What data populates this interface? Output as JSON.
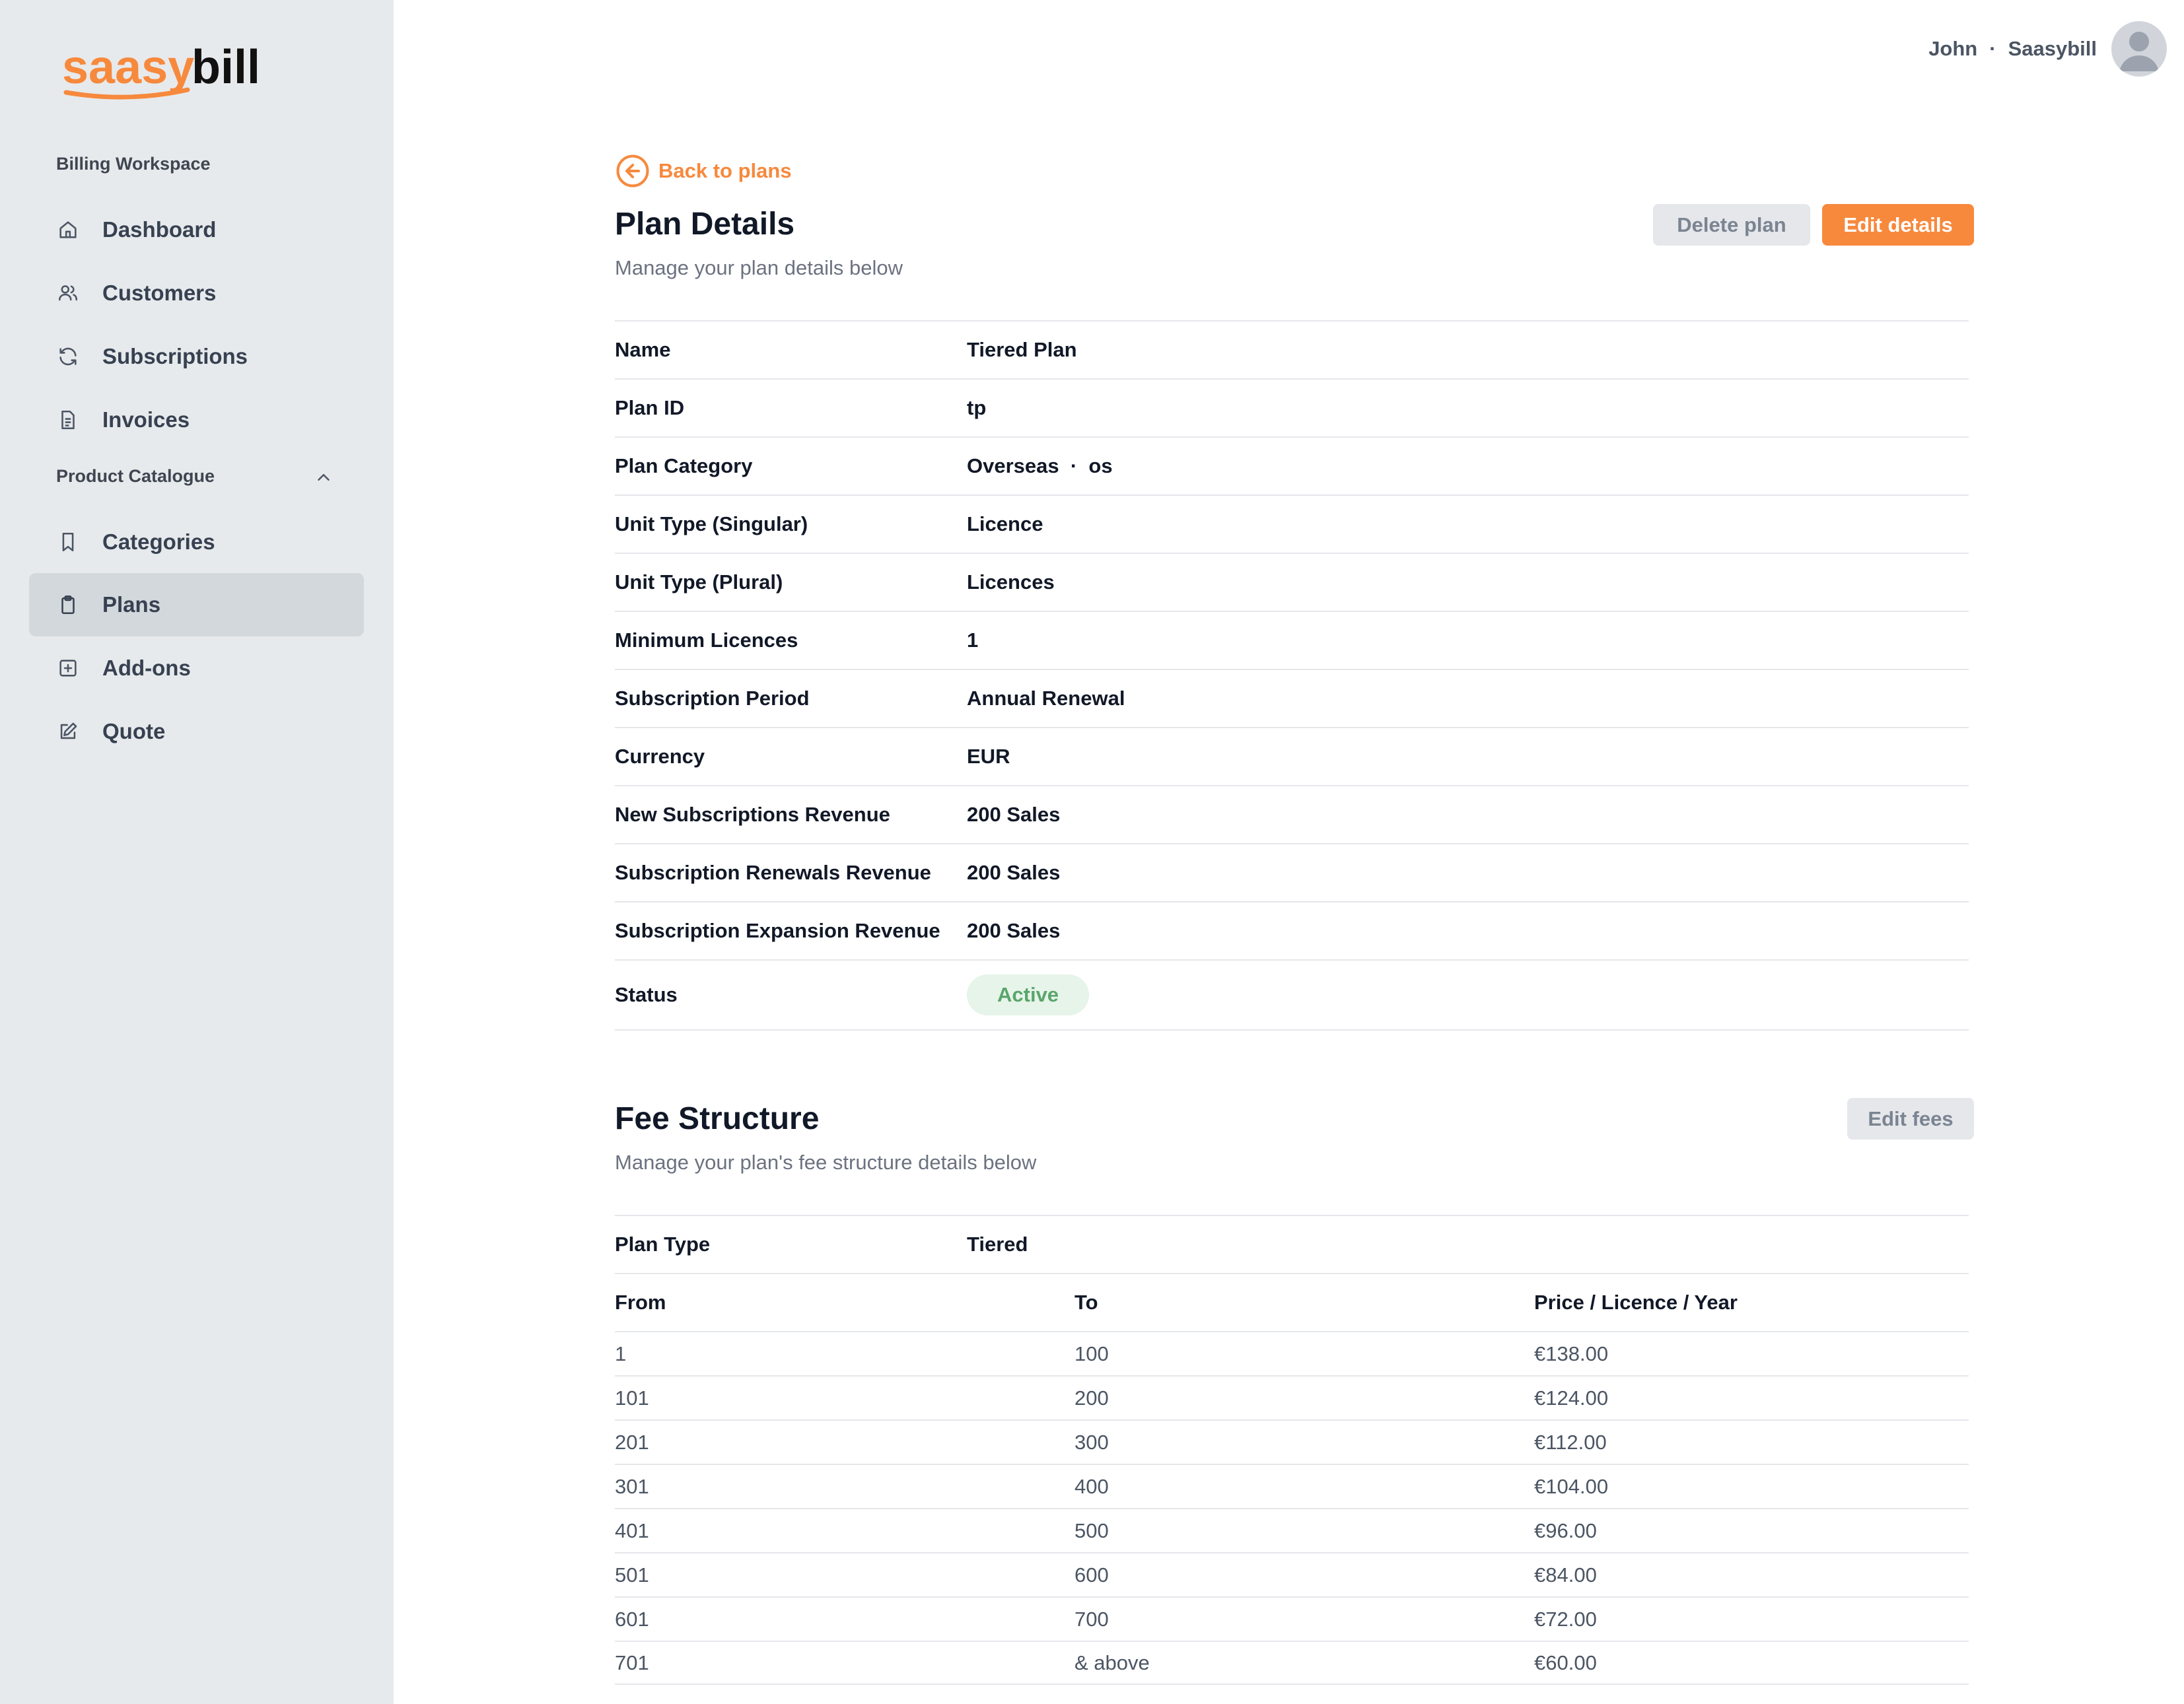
{
  "brand": {
    "logo_text_left": "saasy",
    "logo_text_right": "bill",
    "accent": "#f7893d"
  },
  "sidebar": {
    "workspace_label": "Billing Workspace",
    "catalogue_label": "Product Catalogue",
    "items": [
      {
        "label": "Dashboard",
        "icon": "home-icon"
      },
      {
        "label": "Customers",
        "icon": "users-icon"
      },
      {
        "label": "Subscriptions",
        "icon": "refresh-icon"
      },
      {
        "label": "Invoices",
        "icon": "document-icon"
      },
      {
        "label": "Categories",
        "icon": "bookmark-icon"
      },
      {
        "label": "Plans",
        "icon": "clipboard-icon",
        "active": true
      },
      {
        "label": "Add-ons",
        "icon": "plus-square-icon"
      },
      {
        "label": "Quote",
        "icon": "edit-icon"
      }
    ]
  },
  "header": {
    "user_name": "John",
    "separator": "·",
    "org_name": "Saasybill"
  },
  "plan": {
    "back_label": "Back to plans",
    "title": "Plan Details",
    "subtitle": "Manage your plan details below",
    "delete_label": "Delete plan",
    "edit_label": "Edit details",
    "details": [
      {
        "key": "Name",
        "value": "Tiered Plan"
      },
      {
        "key": "Plan ID",
        "value": "tp"
      },
      {
        "key": "Plan Category",
        "value": "Overseas  ·  os"
      },
      {
        "key": "Unit Type (Singular)",
        "value": "Licence"
      },
      {
        "key": "Unit Type (Plural)",
        "value": "Licences"
      },
      {
        "key": "Minimum Licences",
        "value": "1"
      },
      {
        "key": "Subscription Period",
        "value": "Annual Renewal"
      },
      {
        "key": "Currency",
        "value": "EUR"
      },
      {
        "key": "New Subscriptions Revenue",
        "value": "200 Sales"
      },
      {
        "key": "Subscription Renewals Revenue",
        "value": "200 Sales"
      },
      {
        "key": "Subscription Expansion Revenue",
        "value": "200 Sales"
      }
    ],
    "status_key": "Status",
    "status_value": "Active"
  },
  "fees": {
    "title": "Fee Structure",
    "subtitle": "Manage your plan's fee structure details below",
    "edit_label": "Edit fees",
    "plan_type_key": "Plan Type",
    "plan_type_value": "Tiered",
    "columns": [
      "From",
      "To",
      "Price / Licence / Year"
    ],
    "tiers": [
      [
        "1",
        "100",
        "€138.00"
      ],
      [
        "101",
        "200",
        "€124.00"
      ],
      [
        "201",
        "300",
        "€112.00"
      ],
      [
        "301",
        "400",
        "€104.00"
      ],
      [
        "401",
        "500",
        "€96.00"
      ],
      [
        "501",
        "600",
        "€84.00"
      ],
      [
        "601",
        "700",
        "€72.00"
      ],
      [
        "701",
        "& above",
        "€60.00"
      ]
    ]
  }
}
